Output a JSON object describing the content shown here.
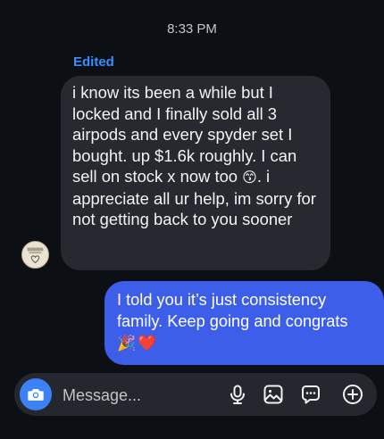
{
  "header": {
    "timestamp": "8:33 PM"
  },
  "incoming_message": {
    "edited_label": "Edited",
    "text_before_emoji": "i know its been a while but I locked and I finally sold all 3 airpods and every spyder set I bought. up $1.6k roughly. I can sell on stock x now too ",
    "emoji": "😙",
    "text_after_emoji": ". i appreciate all ur help, im sorry for not getting back to you sooner",
    "avatar_icon": "avatar-sticker"
  },
  "outgoing_message": {
    "text": "I told you it’s just consistency family. Keep going and congrats",
    "emojis": "🎉❤️"
  },
  "composer": {
    "placeholder": "Message...",
    "icons": [
      "camera-icon",
      "microphone-icon",
      "gallery-icon",
      "sticker-icon",
      "plus-icon"
    ],
    "accent_color": "#3b82f6"
  }
}
